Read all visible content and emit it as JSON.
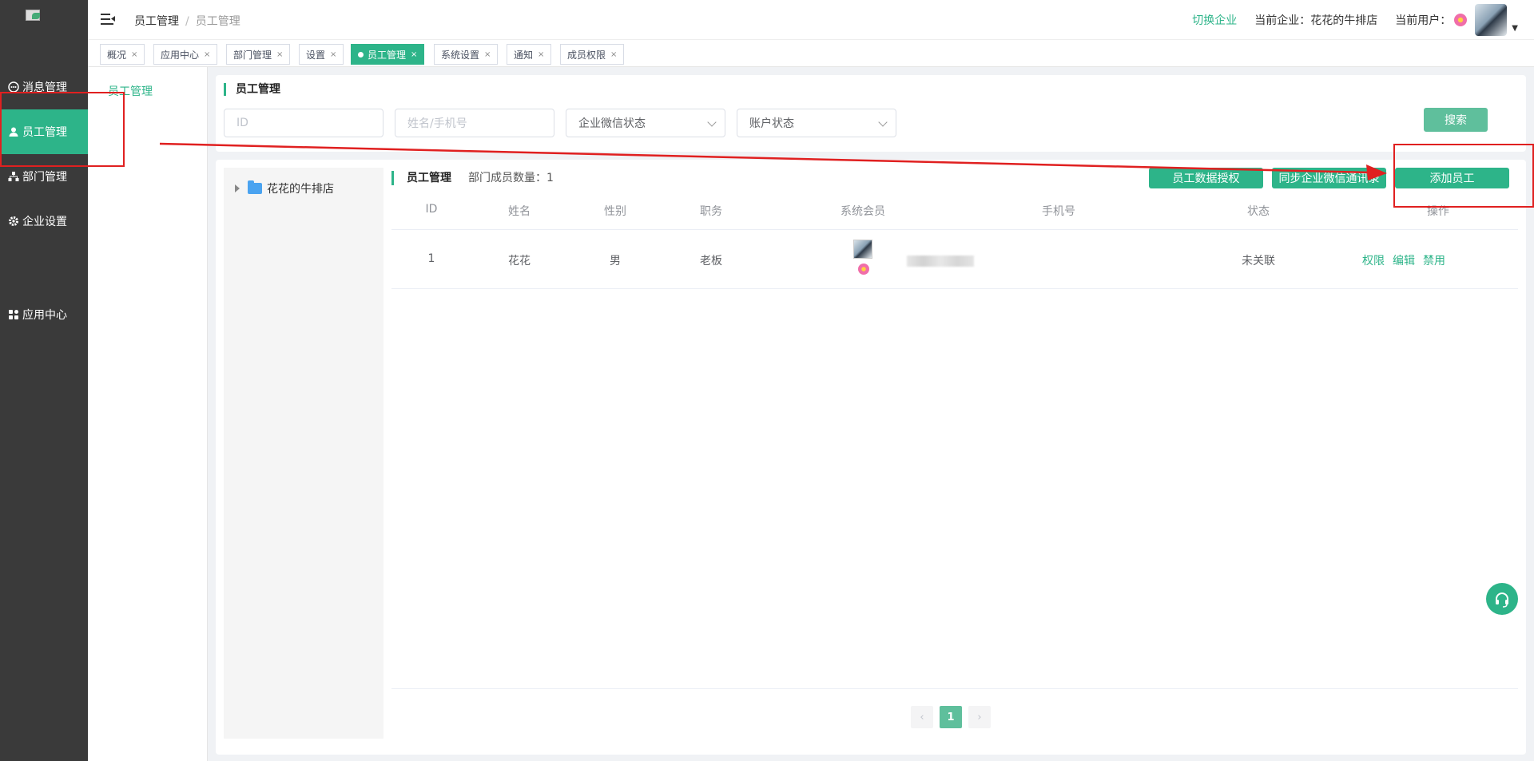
{
  "sidebar": {
    "items": [
      {
        "label": "消息管理",
        "icon": "message-icon"
      },
      {
        "label": "员工管理",
        "icon": "user-icon"
      },
      {
        "label": "部门管理",
        "icon": "org-chart-icon"
      },
      {
        "label": "企业设置",
        "icon": "gear-icon"
      },
      {
        "label": "应用中心",
        "icon": "apps-grid-icon"
      }
    ]
  },
  "subnav": {
    "item": "员工管理"
  },
  "header": {
    "breadcrumb_root": "员工管理",
    "breadcrumb_sep": "/",
    "breadcrumb_current": "员工管理",
    "switch_company": "切换企业",
    "current_company": "当前企业：花花的牛排店",
    "current_user": "当前用户："
  },
  "tabs": [
    {
      "label": "概况"
    },
    {
      "label": "应用中心"
    },
    {
      "label": "部门管理"
    },
    {
      "label": "设置"
    },
    {
      "label": "员工管理",
      "active": true
    },
    {
      "label": "系统设置"
    },
    {
      "label": "通知"
    },
    {
      "label": "成员权限"
    }
  ],
  "tab_close": "×",
  "filter": {
    "title": "员工管理",
    "id_placeholder": "ID",
    "name_placeholder": "姓名/手机号",
    "wechat_status": "企业微信状态",
    "account_status": "账户状态",
    "search": "搜索"
  },
  "tree": {
    "root": "花花的牛排店"
  },
  "list": {
    "title": "员工管理",
    "member_count": "部门成员数量：1",
    "btn_data_auth": "员工数据授权",
    "btn_sync": "同步企业微信通讯录",
    "btn_add": "添加员工"
  },
  "table": {
    "headers": [
      "ID",
      "姓名",
      "性别",
      "职务",
      "系统会员",
      "手机号",
      "状态",
      "操作"
    ],
    "rows": [
      {
        "id": "1",
        "name": "花花",
        "gender": "男",
        "position": "老板",
        "status": "未关联",
        "ops": [
          "权限",
          "编辑",
          "禁用"
        ]
      }
    ]
  },
  "pagination": {
    "prev": "‹",
    "current": "1",
    "next": "›"
  },
  "colors": {
    "accent": "#2db489",
    "sidebar": "#3a3a3a",
    "annotation": "#e02020"
  }
}
